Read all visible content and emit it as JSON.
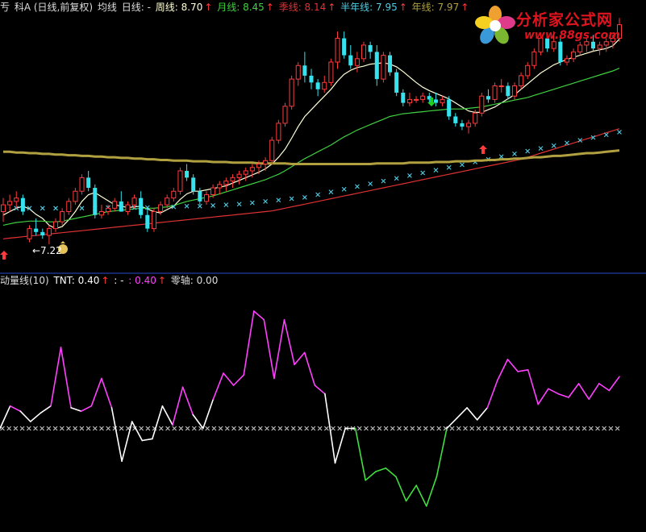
{
  "header_top": {
    "t0": "亐",
    "t1": "科A (日线,前复权)",
    "t2": "均线",
    "t3": "日线: -",
    "t4": "周线: 8.70",
    "t5": "月线: 8.45",
    "t6": "季线: 8.14",
    "t7": "半年线: 7.95",
    "t8": "年线: 7.97"
  },
  "header_bottom": {
    "b0": "动量线(10)",
    "b1": "TNT: 0.40",
    "b2": ": -",
    "b3": ": 0.40",
    "b4": "零轴: 0.00"
  },
  "watermark": {
    "title": "分析家公式网",
    "url": "www.88gs.com"
  },
  "colors": {
    "up": "#ff3b3b",
    "down": "#35e2ee",
    "ma_week": "#ffffd8",
    "ma_month": "#40d040",
    "ma_quarter": "#e03232",
    "ma_halfyear": "#50d0e8",
    "ma_year": "#b0a040",
    "mom_up": "#ff40ff",
    "mom_mid": "#ffffff",
    "mom_down": "#40e040",
    "zero_axis": "#c8c8c8"
  },
  "chart_data": [
    {
      "type": "candlestick",
      "title": "科A (日线,前复权)",
      "ylim": [
        6.9,
        10.6
      ],
      "annotations": [
        {
          "text": "←7.22",
          "value": 7.22
        }
      ],
      "ohlc": [
        [
          7.7,
          7.9,
          7.55,
          7.8
        ],
        [
          7.8,
          7.95,
          7.7,
          7.85
        ],
        [
          7.85,
          8.0,
          7.75,
          7.9
        ],
        [
          7.9,
          7.95,
          7.65,
          7.7
        ],
        [
          7.3,
          7.5,
          7.25,
          7.45
        ],
        [
          7.45,
          7.6,
          7.35,
          7.4
        ],
        [
          7.4,
          7.45,
          7.3,
          7.35
        ],
        [
          7.35,
          7.5,
          7.22,
          7.45
        ],
        [
          7.45,
          7.6,
          7.4,
          7.55
        ],
        [
          7.55,
          7.75,
          7.5,
          7.7
        ],
        [
          7.7,
          7.9,
          7.65,
          7.85
        ],
        [
          7.85,
          8.05,
          7.8,
          8.0
        ],
        [
          8.0,
          8.25,
          7.95,
          8.2
        ],
        [
          8.2,
          8.3,
          8.0,
          8.05
        ],
        [
          8.05,
          8.1,
          7.6,
          7.65
        ],
        [
          7.65,
          7.8,
          7.6,
          7.7
        ],
        [
          7.7,
          7.8,
          7.65,
          7.75
        ],
        [
          7.75,
          7.9,
          7.7,
          7.85
        ],
        [
          7.85,
          8.0,
          7.75,
          7.7
        ],
        [
          7.7,
          7.85,
          7.65,
          7.8
        ],
        [
          7.8,
          7.95,
          7.75,
          7.9
        ],
        [
          7.9,
          8.0,
          7.6,
          7.65
        ],
        [
          7.65,
          7.75,
          7.4,
          7.45
        ],
        [
          7.45,
          7.75,
          7.4,
          7.7
        ],
        [
          7.7,
          7.85,
          7.65,
          7.8
        ],
        [
          7.8,
          7.95,
          7.75,
          7.9
        ],
        [
          7.9,
          8.05,
          7.85,
          8.0
        ],
        [
          8.0,
          8.35,
          7.95,
          8.3
        ],
        [
          8.3,
          8.4,
          8.15,
          8.2
        ],
        [
          8.2,
          8.25,
          7.95,
          8.0
        ],
        [
          8.0,
          8.05,
          7.8,
          7.85
        ],
        [
          7.85,
          8.0,
          7.8,
          7.95
        ],
        [
          7.95,
          8.1,
          7.9,
          8.05
        ],
        [
          8.05,
          8.15,
          7.95,
          8.1
        ],
        [
          8.1,
          8.2,
          8.0,
          8.15
        ],
        [
          8.15,
          8.25,
          8.05,
          8.2
        ],
        [
          8.2,
          8.3,
          8.1,
          8.25
        ],
        [
          8.25,
          8.35,
          8.15,
          8.3
        ],
        [
          8.3,
          8.4,
          8.2,
          8.35
        ],
        [
          8.35,
          8.45,
          8.25,
          8.4
        ],
        [
          8.4,
          8.5,
          8.3,
          8.45
        ],
        [
          8.45,
          8.8,
          8.4,
          8.75
        ],
        [
          8.75,
          9.05,
          8.7,
          9.0
        ],
        [
          9.0,
          9.3,
          8.95,
          9.25
        ],
        [
          9.25,
          9.7,
          9.2,
          9.65
        ],
        [
          9.65,
          9.9,
          9.55,
          9.85
        ],
        [
          9.85,
          10.05,
          9.6,
          9.7
        ],
        [
          9.7,
          9.8,
          9.5,
          9.6
        ],
        [
          9.6,
          9.65,
          9.4,
          9.5
        ],
        [
          9.5,
          9.7,
          9.45,
          9.6
        ],
        [
          9.6,
          9.95,
          9.55,
          9.9
        ],
        [
          9.9,
          10.35,
          9.8,
          10.25
        ],
        [
          10.25,
          10.35,
          9.95,
          10.0
        ],
        [
          10.0,
          10.15,
          9.8,
          9.85
        ],
        [
          9.85,
          10.05,
          9.75,
          9.95
        ],
        [
          9.95,
          10.2,
          9.9,
          10.15
        ],
        [
          10.15,
          10.2,
          9.95,
          10.05
        ],
        [
          10.05,
          10.15,
          9.55,
          9.65
        ],
        [
          9.65,
          10.05,
          9.6,
          10.0
        ],
        [
          10.0,
          10.05,
          9.7,
          9.75
        ],
        [
          9.75,
          9.8,
          9.4,
          9.45
        ],
        [
          9.45,
          9.5,
          9.25,
          9.3
        ],
        [
          9.3,
          9.45,
          9.25,
          9.35
        ],
        [
          9.35,
          9.4,
          9.3,
          9.35
        ],
        [
          9.35,
          9.45,
          9.3,
          9.4
        ],
        [
          9.4,
          9.45,
          9.3,
          9.35
        ],
        [
          9.35,
          9.45,
          9.25,
          9.3
        ],
        [
          9.3,
          9.4,
          9.25,
          9.35
        ],
        [
          9.35,
          9.4,
          9.05,
          9.1
        ],
        [
          9.1,
          9.15,
          8.95,
          9.0
        ],
        [
          9.0,
          9.05,
          8.9,
          8.95
        ],
        [
          8.95,
          9.05,
          8.85,
          9.0
        ],
        [
          9.0,
          9.2,
          8.95,
          9.15
        ],
        [
          9.15,
          9.45,
          9.1,
          9.4
        ],
        [
          9.4,
          9.5,
          9.3,
          9.35
        ],
        [
          9.35,
          9.6,
          9.3,
          9.55
        ],
        [
          9.55,
          9.65,
          9.45,
          9.55
        ],
        [
          9.55,
          9.6,
          9.35,
          9.4
        ],
        [
          9.4,
          9.6,
          9.35,
          9.55
        ],
        [
          9.55,
          9.75,
          9.5,
          9.7
        ],
        [
          9.7,
          9.9,
          9.65,
          9.85
        ],
        [
          9.85,
          10.1,
          9.8,
          10.05
        ],
        [
          10.05,
          10.3,
          10.0,
          10.25
        ],
        [
          10.25,
          10.3,
          10.05,
          10.1
        ],
        [
          10.1,
          10.35,
          10.05,
          10.2
        ],
        [
          10.2,
          10.25,
          9.85,
          9.9
        ],
        [
          9.9,
          10.0,
          9.85,
          9.95
        ],
        [
          9.95,
          10.1,
          9.9,
          10.05
        ],
        [
          10.05,
          10.2,
          10.0,
          10.15
        ],
        [
          10.15,
          10.25,
          10.05,
          10.2
        ],
        [
          10.2,
          10.3,
          10.05,
          10.1
        ],
        [
          10.1,
          10.2,
          10.0,
          10.15
        ],
        [
          10.15,
          10.25,
          10.05,
          10.2
        ],
        [
          10.2,
          10.3,
          10.1,
          10.25
        ],
        [
          10.25,
          10.55,
          10.2,
          10.45
        ]
      ],
      "series": [
        {
          "name": "周线",
          "values": [
            7.65,
            7.7,
            7.75,
            7.78,
            7.74,
            7.66,
            7.6,
            7.5,
            7.45,
            7.48,
            7.58,
            7.7,
            7.85,
            7.95,
            7.98,
            7.92,
            7.86,
            7.8,
            7.78,
            7.76,
            7.77,
            7.78,
            7.74,
            7.7,
            7.68,
            7.73,
            7.78,
            7.88,
            7.96,
            8.0,
            8.0,
            8.02,
            8.04,
            8.06,
            8.08,
            8.12,
            8.16,
            8.2,
            8.24,
            8.28,
            8.33,
            8.4,
            8.5,
            8.62,
            8.78,
            8.95,
            9.1,
            9.2,
            9.3,
            9.4,
            9.5,
            9.62,
            9.72,
            9.78,
            9.82,
            9.84,
            9.87,
            9.88,
            9.89,
            9.87,
            9.83,
            9.76,
            9.68,
            9.6,
            9.53,
            9.48,
            9.44,
            9.4,
            9.36,
            9.3,
            9.24,
            9.18,
            9.16,
            9.16,
            9.2,
            9.24,
            9.3,
            9.36,
            9.42,
            9.5,
            9.58,
            9.66,
            9.74,
            9.8,
            9.86,
            9.9,
            9.94,
            9.97,
            10.0,
            10.03,
            10.06,
            10.08,
            10.1,
            10.14,
            10.24
          ]
        },
        {
          "name": "月线",
          "values": [
            7.5,
            7.52,
            7.54,
            7.55,
            7.56,
            7.56,
            7.56,
            7.55,
            7.55,
            7.56,
            7.58,
            7.6,
            7.62,
            7.64,
            7.66,
            7.68,
            7.7,
            7.71,
            7.72,
            7.73,
            7.74,
            7.75,
            7.75,
            7.75,
            7.76,
            7.77,
            7.79,
            7.82,
            7.85,
            7.87,
            7.89,
            7.91,
            7.93,
            7.96,
            7.99,
            8.02,
            8.05,
            8.08,
            8.11,
            8.14,
            8.17,
            8.21,
            8.25,
            8.3,
            8.36,
            8.42,
            8.48,
            8.53,
            8.58,
            8.63,
            8.68,
            8.74,
            8.8,
            8.85,
            8.9,
            8.94,
            8.98,
            9.02,
            9.06,
            9.1,
            9.12,
            9.14,
            9.15,
            9.16,
            9.17,
            9.18,
            9.19,
            9.2,
            9.21,
            9.21,
            9.21,
            9.22,
            9.23,
            9.24,
            9.26,
            9.28,
            9.3,
            9.32,
            9.34,
            9.36,
            9.38,
            9.41,
            9.44,
            9.47,
            9.5,
            9.53,
            9.56,
            9.59,
            9.62,
            9.65,
            9.68,
            9.71,
            9.74,
            9.77,
            9.81
          ]
        },
        {
          "name": "季线",
          "values": [
            7.3,
            7.31,
            7.32,
            7.33,
            7.34,
            7.35,
            7.36,
            7.37,
            7.38,
            7.39,
            7.4,
            7.41,
            7.42,
            7.43,
            7.44,
            7.45,
            7.46,
            7.47,
            7.48,
            7.49,
            7.5,
            7.51,
            7.52,
            7.53,
            7.54,
            7.55,
            7.56,
            7.57,
            7.58,
            7.59,
            7.6,
            7.61,
            7.62,
            7.63,
            7.64,
            7.65,
            7.66,
            7.67,
            7.68,
            7.69,
            7.7,
            7.71,
            7.73,
            7.75,
            7.77,
            7.79,
            7.81,
            7.83,
            7.85,
            7.87,
            7.89,
            7.91,
            7.93,
            7.95,
            7.97,
            7.99,
            8.01,
            8.03,
            8.05,
            8.07,
            8.09,
            8.11,
            8.13,
            8.15,
            8.17,
            8.19,
            8.21,
            8.23,
            8.25,
            8.27,
            8.29,
            8.31,
            8.33,
            8.35,
            8.37,
            8.39,
            8.41,
            8.43,
            8.45,
            8.47,
            8.5,
            8.53,
            8.56,
            8.59,
            8.62,
            8.65,
            8.68,
            8.71,
            8.74,
            8.77,
            8.8,
            8.83,
            8.86,
            8.89,
            8.92
          ]
        },
        {
          "name": "半年线",
          "values": [
            7.75,
            7.75,
            7.75,
            7.75,
            7.75,
            7.75,
            7.75,
            7.75,
            7.75,
            7.75,
            7.75,
            7.75,
            7.75,
            7.75,
            7.75,
            7.75,
            7.76,
            7.76,
            7.76,
            7.76,
            7.76,
            7.76,
            7.76,
            7.76,
            7.77,
            7.77,
            7.77,
            7.77,
            7.78,
            7.78,
            7.78,
            7.79,
            7.79,
            7.8,
            7.8,
            7.81,
            7.81,
            7.82,
            7.83,
            7.84,
            7.85,
            7.86,
            7.87,
            7.88,
            7.89,
            7.9,
            7.91,
            7.93,
            7.95,
            7.97,
            7.99,
            8.01,
            8.03,
            8.05,
            8.07,
            8.09,
            8.11,
            8.13,
            8.15,
            8.17,
            8.19,
            8.21,
            8.23,
            8.25,
            8.27,
            8.29,
            8.31,
            8.33,
            8.35,
            8.37,
            8.39,
            8.41,
            8.43,
            8.45,
            8.47,
            8.49,
            8.51,
            8.53,
            8.55,
            8.57,
            8.59,
            8.61,
            8.63,
            8.65,
            8.67,
            8.69,
            8.71,
            8.73,
            8.75,
            8.77,
            8.79,
            8.81,
            8.83,
            8.85,
            8.87
          ]
        },
        {
          "name": "年线",
          "values": [
            8.58,
            8.58,
            8.57,
            8.57,
            8.56,
            8.56,
            8.55,
            8.55,
            8.54,
            8.54,
            8.53,
            8.53,
            8.52,
            8.52,
            8.51,
            8.51,
            8.5,
            8.5,
            8.49,
            8.49,
            8.48,
            8.48,
            8.47,
            8.47,
            8.46,
            8.46,
            8.45,
            8.45,
            8.45,
            8.44,
            8.44,
            8.44,
            8.43,
            8.43,
            8.43,
            8.42,
            8.42,
            8.42,
            8.42,
            8.41,
            8.41,
            8.41,
            8.41,
            8.41,
            8.4,
            8.4,
            8.4,
            8.4,
            8.4,
            8.4,
            8.4,
            8.4,
            8.4,
            8.4,
            8.4,
            8.4,
            8.4,
            8.41,
            8.41,
            8.41,
            8.41,
            8.41,
            8.42,
            8.42,
            8.42,
            8.42,
            8.43,
            8.43,
            8.43,
            8.44,
            8.44,
            8.44,
            8.45,
            8.45,
            8.46,
            8.46,
            8.47,
            8.47,
            8.48,
            8.48,
            8.49,
            8.5,
            8.5,
            8.51,
            8.52,
            8.52,
            8.53,
            8.54,
            8.55,
            8.56,
            8.56,
            8.57,
            8.58,
            8.59,
            8.6
          ]
        }
      ]
    },
    {
      "type": "line",
      "title": "动量线(10)",
      "ylim": [
        -0.6,
        0.82
      ],
      "zero": 0.0,
      "values": [
        0.0,
        0.13,
        0.1,
        0.04,
        0.09,
        0.13,
        0.47,
        0.12,
        0.1,
        0.13,
        0.29,
        0.12,
        -0.19,
        0.04,
        -0.07,
        -0.06,
        0.13,
        0.02,
        0.24,
        0.08,
        0.0,
        0.17,
        0.32,
        0.25,
        0.31,
        0.68,
        0.63,
        0.29,
        0.63,
        0.37,
        0.44,
        0.25,
        0.2,
        -0.2,
        0.0,
        0.0,
        -0.3,
        -0.25,
        -0.23,
        -0.28,
        -0.42,
        -0.33,
        -0.45,
        -0.28,
        0.0,
        0.06,
        0.12,
        0.05,
        0.12,
        0.28,
        0.4,
        0.33,
        0.34,
        0.14,
        0.23,
        0.2,
        0.18,
        0.26,
        0.17,
        0.26,
        0.22,
        0.3
      ]
    }
  ]
}
